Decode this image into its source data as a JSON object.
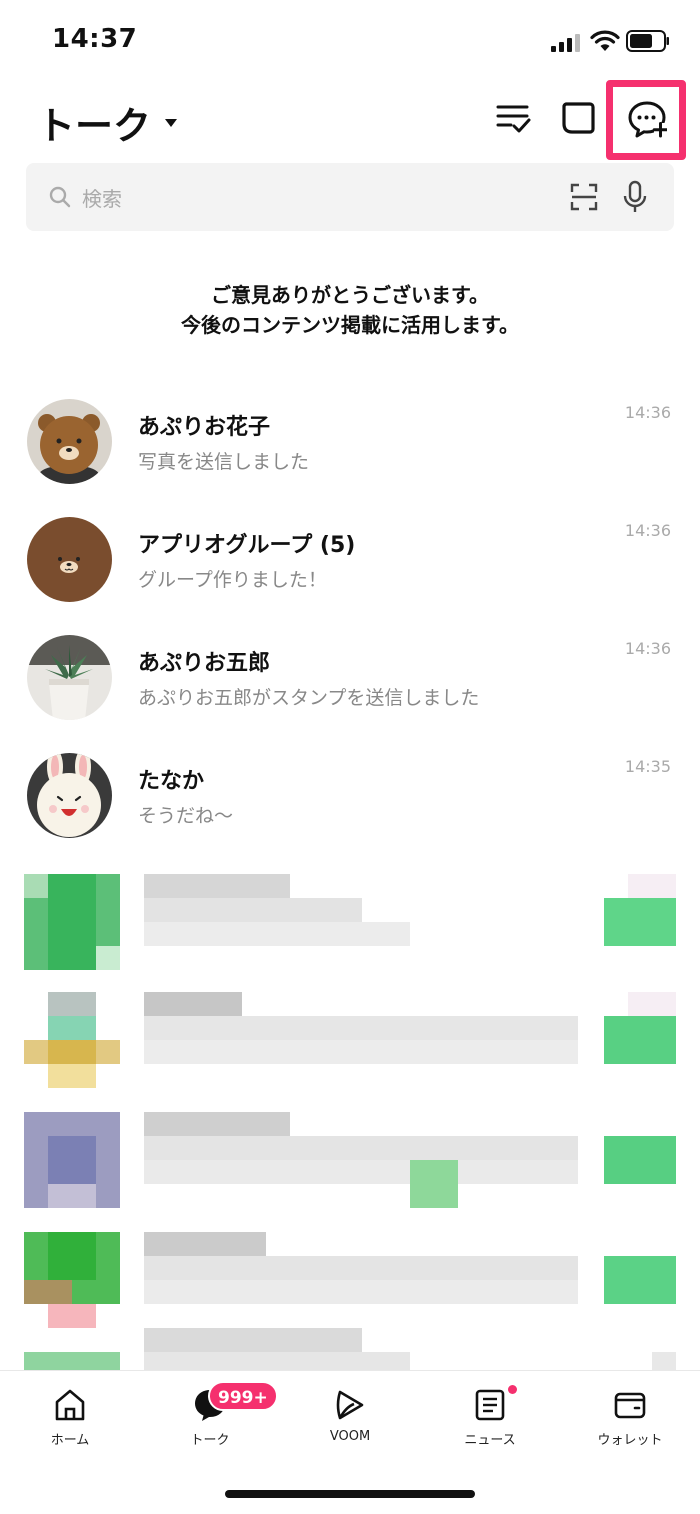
{
  "status_bar": {
    "time": "14:37"
  },
  "header": {
    "title": "トーク",
    "icons": [
      "list-check-icon",
      "open-chat-icon",
      "new-chat-icon"
    ],
    "highlight_color": "#f5306e"
  },
  "search": {
    "placeholder": "検索"
  },
  "notice": {
    "line1": "ご意見ありがとうございます。",
    "line2": "今後のコンテンツ掲載に活用します。"
  },
  "chats": [
    {
      "name": "あぷりお花子",
      "message": "写真を送信しました",
      "time": "14:36",
      "avatar": "brown-bear-plush"
    },
    {
      "name": "アプリオグループ (5)",
      "message": "グループ作りました！",
      "time": "14:36",
      "avatar": "brown-bear-face"
    },
    {
      "name": "あぷりお五郎",
      "message": "あぷりお五郎がスタンプを送信しました",
      "time": "14:36",
      "avatar": "succulent-plant"
    },
    {
      "name": "たなか",
      "message": "そうだね〜",
      "time": "14:35",
      "avatar": "cony-rabbit-plush"
    }
  ],
  "bottom_nav": [
    {
      "label": "ホーム",
      "icon": "home-icon"
    },
    {
      "label": "トーク",
      "icon": "talk-icon",
      "badge": "999+"
    },
    {
      "label": "VOOM",
      "icon": "voom-icon"
    },
    {
      "label": "ニュース",
      "icon": "news-icon",
      "has_dot": true
    },
    {
      "label": "ウォレット",
      "icon": "wallet-icon"
    }
  ],
  "colors": {
    "accent": "#f5306e",
    "line_green": "#06c755"
  }
}
